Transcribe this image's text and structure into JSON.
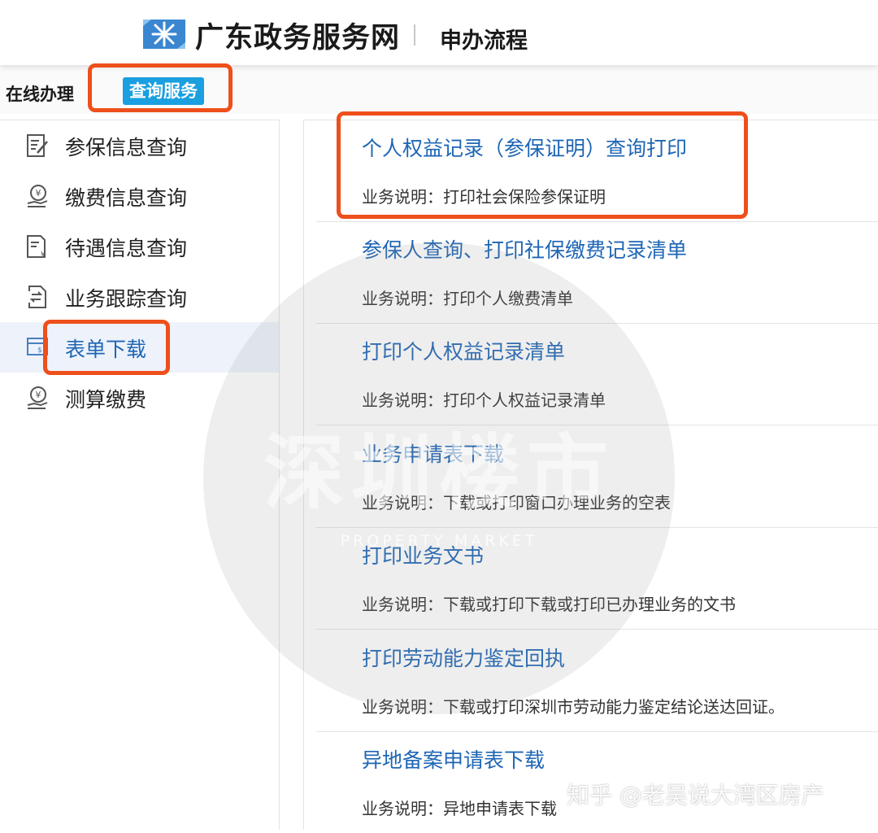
{
  "header": {
    "site_title": "广东政务服务网",
    "page_subtitle": "申办流程",
    "logo_icon": "snowflake-logo-icon"
  },
  "tabs": [
    {
      "label": "在线办理",
      "active": false
    },
    {
      "label": "查询服务",
      "active": true
    }
  ],
  "sidebar": {
    "items": [
      {
        "label": "参保信息查询",
        "icon": "edit-document-icon",
        "active": false
      },
      {
        "label": "缴费信息查询",
        "icon": "payment-hand-icon",
        "active": false
      },
      {
        "label": "待遇信息查询",
        "icon": "yuan-document-icon",
        "active": false
      },
      {
        "label": "业务跟踪查询",
        "icon": "transfer-document-icon",
        "active": false
      },
      {
        "label": "表单下载",
        "icon": "form-download-icon",
        "active": true
      },
      {
        "label": "测算缴费",
        "icon": "payment-hand-icon",
        "active": false
      }
    ]
  },
  "services": [
    {
      "title": "个人权益记录（参保证明）查询打印",
      "desc": "业务说明：打印社会保险参保证明"
    },
    {
      "title": "参保人查询、打印社保缴费记录清单",
      "desc": "业务说明：打印个人缴费清单"
    },
    {
      "title": "打印个人权益记录清单",
      "desc": "业务说明：打印个人权益记录清单"
    },
    {
      "title": "业务申请表下载",
      "desc": "业务说明：下载或打印窗口办理业务的空表"
    },
    {
      "title": "打印业务文书",
      "desc": "业务说明：下载或打印下载或打印已办理业务的文书"
    },
    {
      "title": "打印劳动能力鉴定回执",
      "desc": "业务说明：下载或打印深圳市劳动能力鉴定结论送达回证。"
    },
    {
      "title": "异地备案申请表下载",
      "desc": "业务说明：异地申请表下载"
    }
  ],
  "watermark": {
    "main": "深圳楼市",
    "sub": "PROPERTY MARKET",
    "zhihu": "知乎 @老吴说大湾区房产"
  },
  "colors": {
    "accent_blue": "#1a9fe0",
    "link_blue": "#1e66b5",
    "highlight_orange": "#ee4f1b"
  }
}
